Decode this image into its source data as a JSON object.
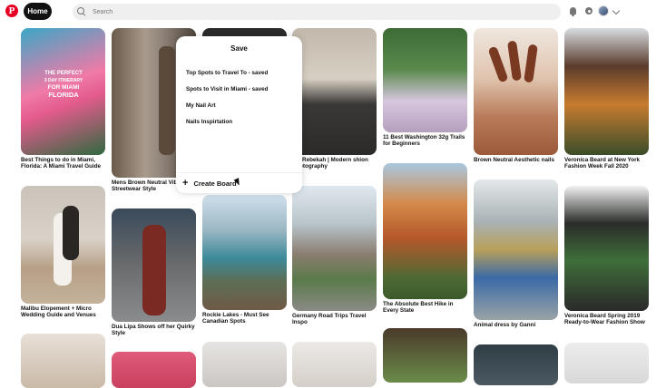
{
  "header": {
    "logo_glyph": "P",
    "home_label": "Home",
    "search_placeholder": "Search"
  },
  "icons": {
    "logo": "pinterest-logo",
    "search": "search-icon",
    "notifications": "bell-icon",
    "messages": "chat-icon",
    "avatar": "avatar",
    "account": "chevron-down-icon"
  },
  "colors": {
    "brand": "#e60023",
    "home_bg": "#111111",
    "search_bg": "#efefef"
  },
  "pins": [
    {
      "title": "Best Things to do in Miami, Florida: A Miami Travel Guide"
    },
    {
      "title": "Mens Brown Neutral Vibe Streetwear Style"
    },
    {
      "title": ""
    },
    {
      "title": "h + Rebekah | Modern shion Photography"
    },
    {
      "title": "11 Best Washington 32g Trails for Beginners"
    },
    {
      "title": "Brown Neutral Aesthetic nails"
    },
    {
      "title": "Veronica Beard at New York Fashion Week Fall 2020"
    },
    {
      "title": "Malibu Elopement + Micro Wedding Guide and Venues"
    },
    {
      "title": "Dua Lipa Shows off her Quirky Style"
    },
    {
      "title": "Rockie Lakes - Must See Canadian Spots"
    },
    {
      "title": "Germany Road Trips Travel Inspo"
    },
    {
      "title": "The Absolute Best Hike in Every State"
    },
    {
      "title": "Animal dress by Ganni"
    },
    {
      "title": "Veronica Beard Spring 2019 Ready-to-Wear Fashion Show"
    }
  ],
  "poster_text": {
    "line1": "THE PERFECT",
    "line2": "3 DAY ITINERARY",
    "line3": "FOR MIAMI",
    "line4": "FLORIDA"
  },
  "save_dialog": {
    "title": "Save",
    "boards": [
      "Top Spots to Travel To - saved",
      "Spots to Visit in Miami - saved",
      "My Nail Art",
      "Nails Inspirtation"
    ],
    "create_label": "Create Board",
    "create_icon": "plus-icon"
  }
}
